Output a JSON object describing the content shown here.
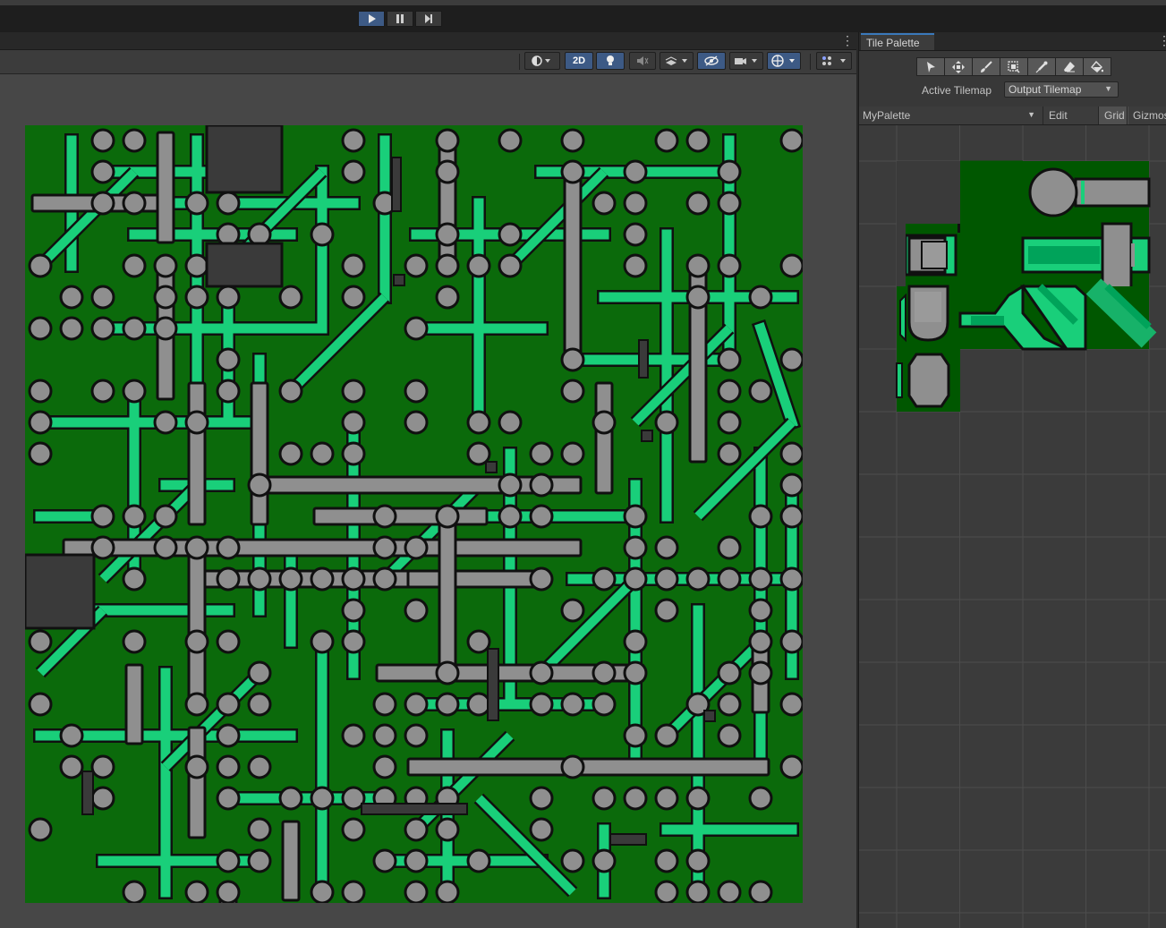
{
  "toolbar_play": {
    "buttons": [
      {
        "name": "play-button",
        "icon": "play-icon",
        "active": true
      },
      {
        "name": "pause-button",
        "icon": "pause-icon",
        "active": false
      },
      {
        "name": "step-button",
        "icon": "step-forward-icon",
        "active": false
      }
    ]
  },
  "scene_view": {
    "toolbar": {
      "mode_2d_label": "2D",
      "icons": [
        "shading-mode-icon",
        "lighting-icon",
        "audio-icon",
        "effects-icon",
        "scene-visibility-icon",
        "camera-icon",
        "gizmo-orientation-icon",
        "grid-snapping-icon"
      ]
    }
  },
  "tile_palette": {
    "tab_title": "Tile Palette",
    "tools": [
      "select-icon",
      "move-icon",
      "brush-icon",
      "box-fill-icon",
      "picker-icon",
      "eraser-icon",
      "fill-icon"
    ],
    "active_tilemap_label": "Active Tilemap",
    "active_tilemap_value": "Output Tilemap",
    "palette_name": "MyPalette",
    "edit_label": "Edit",
    "grid_label": "Grid",
    "gizmos_label": "Gizmos"
  },
  "colors": {
    "board": "#0b6a0b",
    "board_dark": "#005700",
    "trace": "#19cf7a",
    "trace_dark": "#00a35a",
    "pad": "#8f8f8f",
    "chip": "#3a3a3a",
    "outline": "#101010",
    "accent": "#3d5a85"
  }
}
